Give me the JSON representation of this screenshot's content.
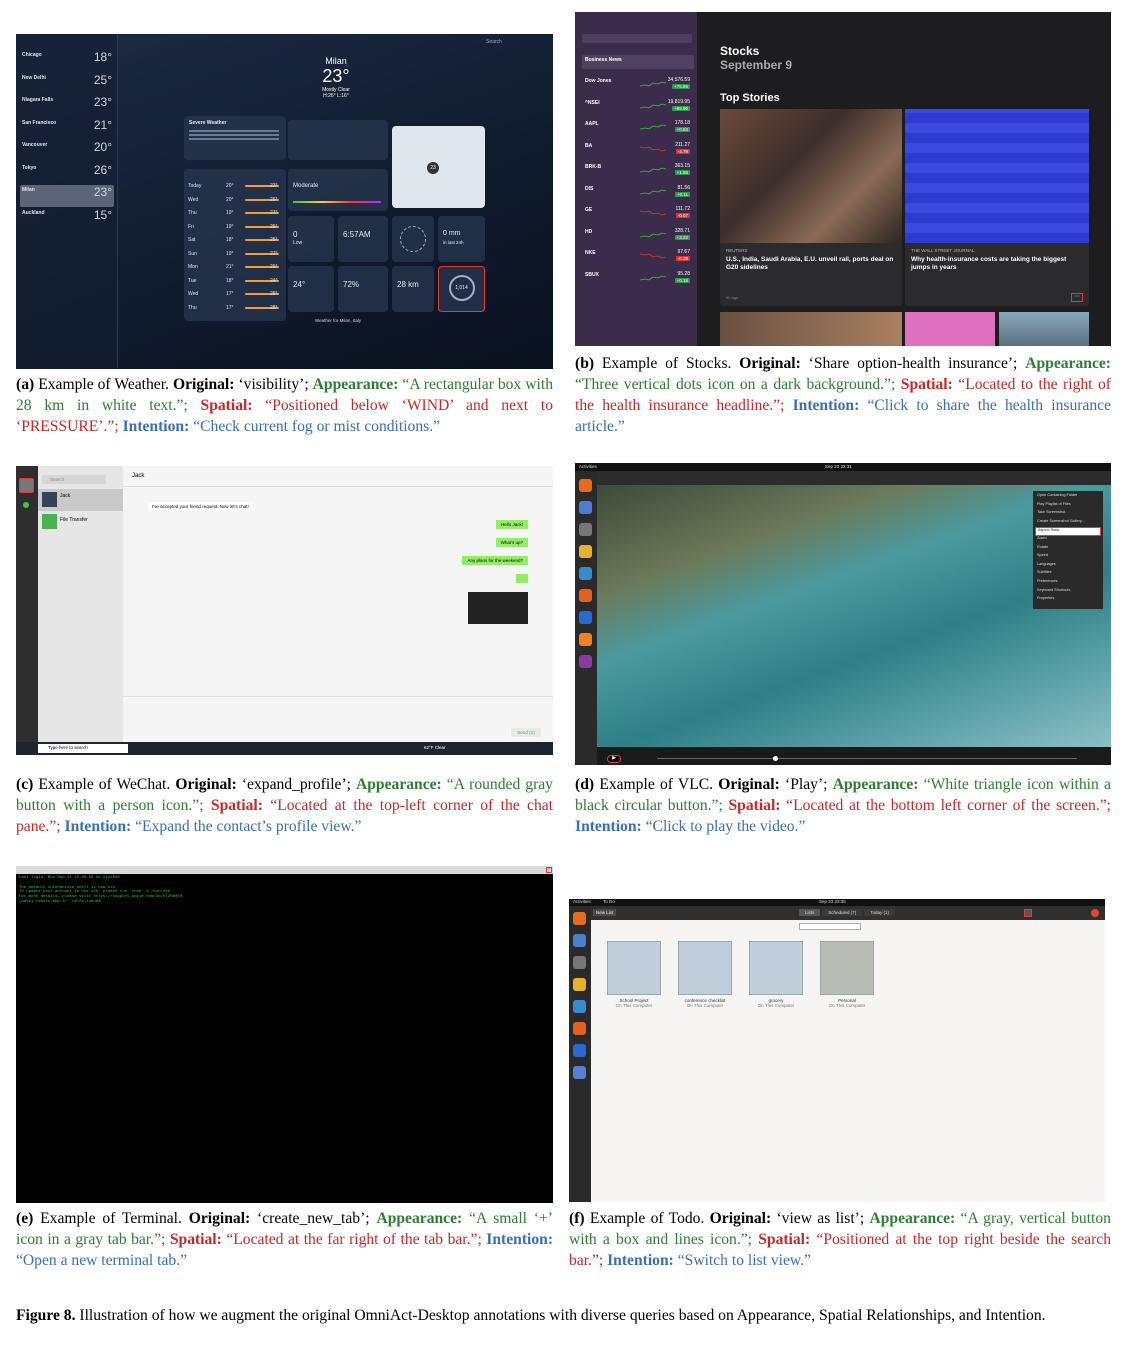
{
  "weather": {
    "sidebar": [
      {
        "city": "Chicago",
        "temp": "18°"
      },
      {
        "city": "New Delhi",
        "temp": "25°"
      },
      {
        "city": "Niagara Falls",
        "temp": "23°"
      },
      {
        "city": "San Francisco",
        "temp": "21°"
      },
      {
        "city": "Vancouver",
        "temp": "20°"
      },
      {
        "city": "Tokyo",
        "temp": "26°"
      },
      {
        "city": "Milan",
        "temp": "23°"
      },
      {
        "city": "Auckland",
        "temp": "15°"
      }
    ],
    "search": "Search",
    "city": "Milan",
    "temp": "23°",
    "cond": "Mostly Clear",
    "hl": "H:26° L:16°",
    "alert": "Severe Weather",
    "uv_val": "0",
    "uv_lbl": "Low",
    "sunset": "6:57AM",
    "precip": "0 mm",
    "precip_sub": "in last 24h",
    "aq": "Moderate",
    "feels": "24°",
    "humidity": "72%",
    "visibility": "28 km",
    "pressure": "1,014",
    "forecast": [
      {
        "d": "Today",
        "l": "20°",
        "h": "23°"
      },
      {
        "d": "Wed",
        "l": "20°",
        "h": "26°"
      },
      {
        "d": "Thu",
        "l": "19°",
        "h": "27°"
      },
      {
        "d": "Fri",
        "l": "19°",
        "h": "25°"
      },
      {
        "d": "Sat",
        "l": "18°",
        "h": "25°"
      },
      {
        "d": "Sun",
        "l": "19°",
        "h": "27°"
      },
      {
        "d": "Mon",
        "l": "21°",
        "h": "26°"
      },
      {
        "d": "Tue",
        "l": "18°",
        "h": "24°"
      },
      {
        "d": "Wed",
        "l": "17°",
        "h": "25°"
      },
      {
        "d": "Thu",
        "l": "17°",
        "h": "28°"
      }
    ],
    "footer": "Weather for Milan, Italy"
  },
  "stocks": {
    "title": "Stocks",
    "date": "September 9",
    "top": "Top Stories",
    "section": "Business News",
    "rows": [
      {
        "k": "Dow Jones",
        "p": "34,576.59",
        "c": "+75.86",
        "up": true
      },
      {
        "k": "^NSEI",
        "p": "19,819.95",
        "c": "+89.90",
        "up": true
      },
      {
        "k": "AAPL",
        "p": "178.18",
        "c": "+0.83",
        "up": true
      },
      {
        "k": "BA",
        "p": "211.27",
        "c": "-4.79",
        "up": false
      },
      {
        "k": "BRK-B",
        "p": "363.15",
        "c": "+1.88",
        "up": true
      },
      {
        "k": "DIS",
        "p": "81.56",
        "c": "+0.11",
        "up": true
      },
      {
        "k": "GE",
        "p": "111.72",
        "c": "-0.07",
        "up": false
      },
      {
        "k": "HD",
        "p": "328.71",
        "c": "+3.22",
        "up": true
      },
      {
        "k": "NKE",
        "p": "97.67",
        "c": "-0.39",
        "up": false
      },
      {
        "k": "SBUX",
        "p": "95.28",
        "c": "+0.18",
        "up": true
      }
    ],
    "headline1": "U.S., India, Saudi Arabia, E.U. unveil rail, ports deal on G20 sidelines",
    "src1": "REUTERS",
    "src2": "THE WALL STREET JOURNAL.",
    "headline2": "Why health-insurance costs are taking the biggest jumps in years",
    "time": "9h ago"
  },
  "wechat": {
    "contact": "Jack",
    "search": "Search",
    "chat1": "Jack",
    "chat2": "File Transfer",
    "m0": "I've accepted your friend request. Now let's chat!",
    "m1": "Hello Jack!",
    "m2": "What's up?",
    "m3": "Any plans for the weekend?",
    "send": "Send (S)",
    "taskbar": "Type here to search",
    "weather": "62°F Clear"
  },
  "vlc": {
    "activities": "Activities",
    "date": "Sep 23 22:31",
    "menu": [
      "Open Containing Folder",
      "Play Playlist of Files",
      "Take Screenshot",
      "Create Screenshot Gallery...",
      "Aspect Ratio",
      "Zoom",
      "Rotate",
      "Speed",
      "Languages",
      "Subtitles",
      "Preferences",
      "Keyboard Shortcuts",
      "Properties"
    ]
  },
  "terminal": {
    "lines": [
      "Last login: Mon Sep 11 15:46:59 on ttys000",
      "",
      "The default interactive shell is now zsh.",
      "To update your account to use zsh, please run `chsh -s /bin/zsh`.",
      "For more details, please visit https://support.apple.com/kb/HT208050.",
      "(base) rahuls-mbp-3:~ ralfaliuhne$"
    ]
  },
  "todo": {
    "activities": "Activities",
    "app": "To Do",
    "date": "Sep 23 23:35",
    "new_list": "New List",
    "tabs": [
      "Lists",
      "Scheduled (7)",
      "Today (1)"
    ],
    "cards": [
      {
        "name": "School Project",
        "sub": "On This Computer"
      },
      {
        "name": "conference checklist",
        "sub": "On This Computer"
      },
      {
        "name": "grocery",
        "sub": "On This Computer"
      },
      {
        "name": "Personal",
        "sub": "On This Computer"
      }
    ]
  },
  "captions": {
    "a": {
      "lbl": "(a)",
      "t1": "Example of Weather. ",
      "o": "Original:",
      "ov": " ‘visibility’; ",
      "ap": "Appearance:",
      "apv": " “A rectangular box with 28 km in white text.”; ",
      "sp": "Spatial:",
      "spv": " “Positioned below ‘WIND’ and next to ‘PRESSURE’.”; ",
      "in": "Intention:",
      "inv": " “Check current fog or mist conditions.”"
    },
    "b": {
      "lbl": "(b)",
      "t1": "Example of Stocks. ",
      "o": "Original:",
      "ov": " ‘Share option-health insurance’; ",
      "ap": "Appearance:",
      "apv": " “Three vertical dots icon on a dark background.”; ",
      "sp": "Spatial:",
      "spv": " “Located to the right of the health insurance headline.”; ",
      "in": "Intention:",
      "inv": " “Click to share the health insurance article.”"
    },
    "c": {
      "lbl": "(c)",
      "t1": "Example of WeChat. ",
      "o": "Original:",
      "ov": " ‘expand_profile’; ",
      "ap": "Appearance:",
      "apv": " “A rounded gray button with a person icon.”; ",
      "sp": "Spatial:",
      "spv": " “Located at the top-left corner of the chat pane.”; ",
      "in": "Intention:",
      "inv": " “Expand the contact’s profile view.”"
    },
    "d": {
      "lbl": "(d)",
      "t1": "Example of VLC. ",
      "o": "Original:",
      "ov": " ‘Play’; ",
      "ap": "Appearance:",
      "apv": " “White triangle icon within a black circular button.”; ",
      "sp": "Spatial:",
      "spv": " “Located at the bottom left corner of the screen.”; ",
      "in": "Intention:",
      "inv": " “Click to play the video.”"
    },
    "e": {
      "lbl": "(e)",
      "t1": "Example of Terminal. ",
      "o": "Original:",
      "ov": " ‘create_new_tab’; ",
      "ap": "Appearance:",
      "apv": " “A small ‘+’ icon in a gray tab bar.”; ",
      "sp": "Spatial:",
      "spv": " “Located at the far right of the tab bar.”; ",
      "in": "Intention:",
      "inv": " “Open a new terminal tab.”"
    },
    "f": {
      "lbl": "(f)",
      "t1": "Example of Todo. ",
      "o": "Original:",
      "ov": " ‘view as list’; ",
      "ap": "Appearance:",
      "apv": " “A gray, vertical button with a box and lines icon.”; ",
      "sp": "Spatial:",
      "spv": " “Positioned at the top right beside the search bar.”; ",
      "in": "Intention:",
      "inv": " “Switch to list view.”"
    }
  },
  "figure": {
    "label": "Figure 8.",
    "text": " Illustration of how we augment the original OmniAct-Desktop annotations with diverse queries based on Appearance, Spatial Relationships, and Intention."
  }
}
